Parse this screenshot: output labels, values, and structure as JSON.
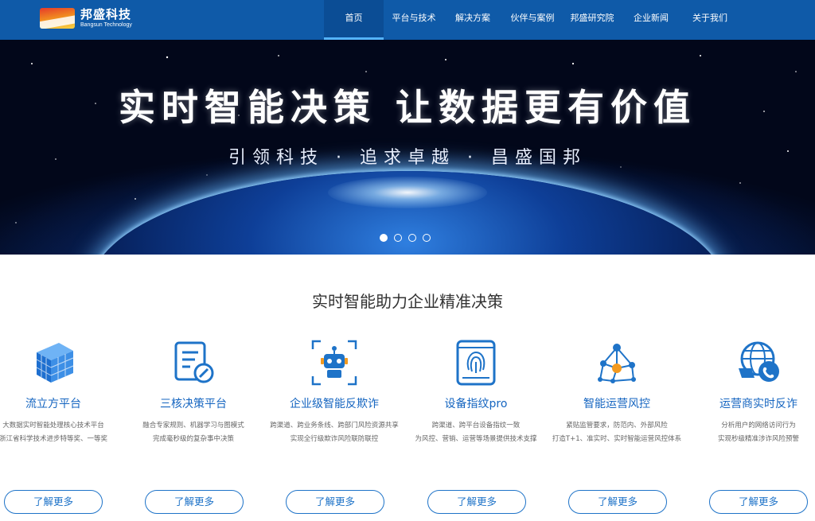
{
  "header": {
    "logo_cn": "邦盛科技",
    "logo_en": "Bangsun Technology",
    "nav": [
      "首页",
      "平台与技术",
      "解决方案",
      "伙伴与案例",
      "邦盛研究院",
      "企业新闻",
      "关于我们"
    ],
    "active_nav": "首页"
  },
  "banner": {
    "title": "实时智能决策  让数据更有价值",
    "subtitle": "引领科技 · 追求卓越 · 昌盛国邦",
    "slides": 4,
    "active_slide": 1
  },
  "section": {
    "title": "实时智能助力企业精准决策",
    "cards": [
      {
        "icon": "cube-icon",
        "title": "流立方平台",
        "desc1": "大数据实时智能处理核心技术平台",
        "desc2": "浙江省科学技术进步特等奖、一等奖",
        "button": "了解更多"
      },
      {
        "icon": "decision-doc-icon",
        "title": "三核决策平台",
        "desc1": "融合专家规则、机器学习与图模式",
        "desc2": "完成毫秒级的复杂事中决策",
        "button": "了解更多"
      },
      {
        "icon": "robot-icon",
        "title": "企业级智能反欺诈",
        "desc1": "跨渠道、跨业务条线、跨部门风险资源共享",
        "desc2": "实现全行级欺诈风险联防联控",
        "button": "了解更多"
      },
      {
        "icon": "fingerprint-icon",
        "title": "设备指纹pro",
        "desc1": "跨渠道、跨平台设备指纹一致",
        "desc2": "为风控、营销、运营等场景提供技术支撑",
        "button": "了解更多"
      },
      {
        "icon": "network-icon",
        "title": "智能运营风控",
        "desc1": "紧贴监管要求，防范内、外部风险",
        "desc2": "打造T+1、准实时、实时智能运营风控体系",
        "button": "了解更多"
      },
      {
        "icon": "globe-phone-icon",
        "title": "运营商实时反诈",
        "desc1": "分析用户的网络访问行为",
        "desc2": "实现秒级精准涉诈风险预警",
        "button": "了解更多"
      }
    ]
  },
  "colors": {
    "header_bg": "#0f5aa8",
    "accent": "#1565c0",
    "button_border": "#1e73c8"
  }
}
